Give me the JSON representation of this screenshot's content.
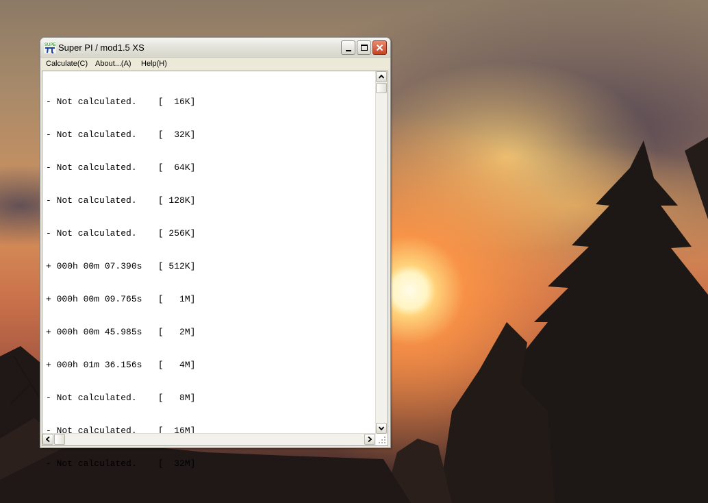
{
  "window": {
    "title": "Super PI / mod1.5 XS",
    "icon": "super-pi-icon",
    "controls": [
      "minimize-icon",
      "maximize-icon",
      "close-icon"
    ]
  },
  "menu": [
    {
      "label": "Calculate(C)"
    },
    {
      "label": "About...(A)"
    },
    {
      "label": "Help(H)"
    }
  ],
  "results": [
    "- Not calculated.    [  16K]",
    "- Not calculated.    [  32K]",
    "- Not calculated.    [  64K]",
    "- Not calculated.    [ 128K]",
    "- Not calculated.    [ 256K]",
    "+ 000h 00m 07.390s   [ 512K]",
    "+ 000h 00m 09.765s   [   1M]",
    "+ 000h 00m 45.985s   [   2M]",
    "+ 000h 01m 36.156s   [   4M]",
    "- Not calculated.    [   8M]",
    "- Not calculated.    [  16M]",
    "- Not calculated.    [  32M]"
  ],
  "colors": {
    "close_button": "#c64524",
    "text": "#000000",
    "client_background": "#ffffff"
  }
}
